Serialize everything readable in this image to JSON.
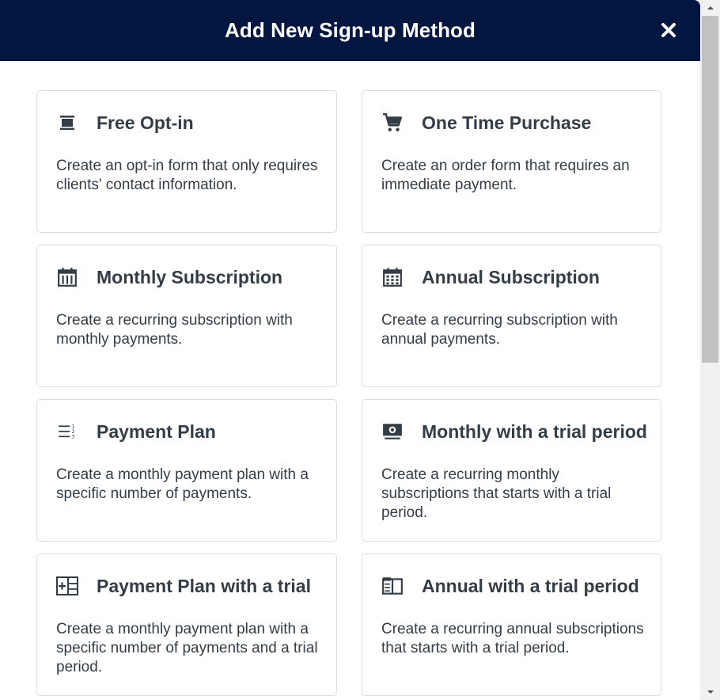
{
  "modal": {
    "title": "Add New Sign-up Method",
    "close_icon": "close-icon"
  },
  "colors": {
    "header_bg": "#021640",
    "header_text": "#ffffff",
    "text": "#333d47",
    "card_border": "#dcdcdc"
  },
  "methods": [
    {
      "title": "Free Opt-in",
      "description": "Create an opt-in form that only requires clients' contact information.",
      "icon": "opt-in-form-icon"
    },
    {
      "title": "One Time Purchase",
      "description": "Create an order form that requires an immediate payment.",
      "icon": "shopping-cart-icon"
    },
    {
      "title": "Monthly Subscription",
      "description": "Create a recurring subscription with monthly payments.",
      "icon": "calendar-icon"
    },
    {
      "title": "Annual Subscription",
      "description": "Create a recurring subscription with annual payments.",
      "icon": "calendar-grid-icon"
    },
    {
      "title": "Payment Plan",
      "description": "Create a monthly payment plan with a specific number of payments.",
      "icon": "numbered-list-icon"
    },
    {
      "title": "Monthly with a trial period",
      "description": "Create a recurring monthly subscriptions that starts with a trial period.",
      "icon": "trial-screen-icon"
    },
    {
      "title": "Payment Plan with a trial",
      "description": "Create a monthly payment plan with a specific number of payments and a trial period.",
      "icon": "plus-grid-icon"
    },
    {
      "title": "Annual with a trial period",
      "description": "Create a recurring annual subscriptions that starts with a trial period.",
      "icon": "layout-panel-icon"
    }
  ]
}
